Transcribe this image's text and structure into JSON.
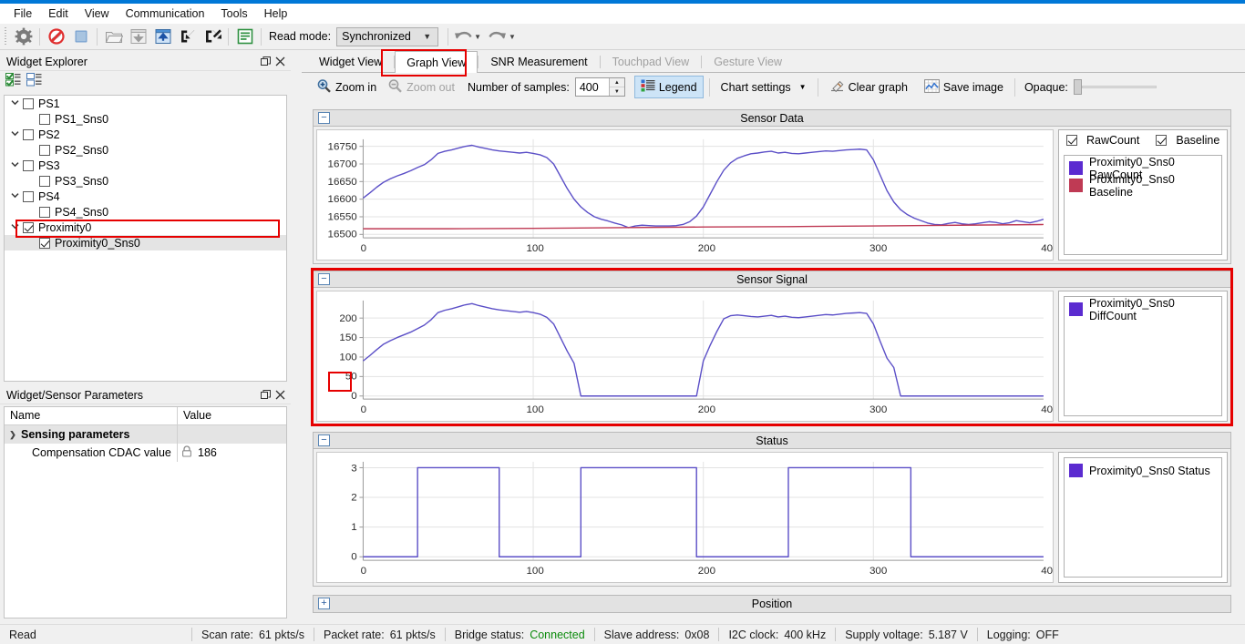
{
  "app": {
    "accent_color": "#0078d7",
    "highlight_color": "#e60000",
    "series_blue": "#5b4fc7",
    "series_red": "#bf3a54"
  },
  "menubar": {
    "items": [
      {
        "label": "File"
      },
      {
        "label": "Edit"
      },
      {
        "label": "View"
      },
      {
        "label": "Communication"
      },
      {
        "label": "Tools"
      },
      {
        "label": "Help"
      }
    ]
  },
  "toolbar": {
    "icons": [
      {
        "name": "configuration-gear-icon"
      },
      {
        "name": "disconnect-icon"
      },
      {
        "name": "stop-icon"
      },
      {
        "name": "open-folder-icon"
      },
      {
        "name": "download-to-device-icon"
      },
      {
        "name": "upload-from-device-icon"
      },
      {
        "name": "import-icon"
      },
      {
        "name": "export-icon"
      },
      {
        "name": "log-icon"
      }
    ],
    "read_mode_label": "Read mode:",
    "read_mode_value": "Synchronized",
    "undo_label": "undo",
    "redo_label": "redo"
  },
  "tabs": [
    {
      "label": "Widget View",
      "selected": false,
      "disabled": false
    },
    {
      "label": "Graph View",
      "selected": true,
      "disabled": false
    },
    {
      "label": "SNR Measurement",
      "selected": false,
      "disabled": false
    },
    {
      "label": "Touchpad View",
      "selected": false,
      "disabled": true
    },
    {
      "label": "Gesture View",
      "selected": false,
      "disabled": true
    }
  ],
  "graph_toolbar": {
    "zoom_in": "Zoom in",
    "zoom_out": "Zoom out",
    "samples_label": "Number of samples:",
    "samples_value": "400",
    "legend_label": "Legend",
    "chart_settings": "Chart settings",
    "clear_graph": "Clear graph",
    "save_image": "Save image",
    "opaque_label": "Opaque:"
  },
  "widget_explorer": {
    "title": "Widget Explorer",
    "toolbar": [
      {
        "name": "check-all-icon"
      },
      {
        "name": "uncheck-all-icon"
      }
    ],
    "float_button": "float",
    "close_button": "close",
    "tree": [
      {
        "label": "PS1",
        "level": 0,
        "checked": false,
        "expandable": true,
        "selected": false
      },
      {
        "label": "PS1_Sns0",
        "level": 1,
        "checked": false,
        "expandable": false,
        "selected": false
      },
      {
        "label": "PS2",
        "level": 0,
        "checked": false,
        "expandable": true,
        "selected": false
      },
      {
        "label": "PS2_Sns0",
        "level": 1,
        "checked": false,
        "expandable": false,
        "selected": false
      },
      {
        "label": "PS3",
        "level": 0,
        "checked": false,
        "expandable": true,
        "selected": false
      },
      {
        "label": "PS3_Sns0",
        "level": 1,
        "checked": false,
        "expandable": false,
        "selected": false
      },
      {
        "label": "PS4",
        "level": 0,
        "checked": false,
        "expandable": true,
        "selected": false
      },
      {
        "label": "PS4_Sns0",
        "level": 1,
        "checked": false,
        "expandable": false,
        "selected": false
      },
      {
        "label": "Proximity0",
        "level": 0,
        "checked": true,
        "expandable": true,
        "selected": false
      },
      {
        "label": "Proximity0_Sns0",
        "level": 1,
        "checked": true,
        "expandable": false,
        "selected": true
      }
    ]
  },
  "params_panel": {
    "title": "Widget/Sensor Parameters",
    "columns": [
      "Name",
      "Value"
    ],
    "rows": [
      {
        "name": "Sensing parameters",
        "value": "",
        "group": true
      },
      {
        "name": "Compensation CDAC value",
        "value": "186",
        "group": false,
        "locked": true
      }
    ]
  },
  "sections": [
    {
      "title": "Sensor Data",
      "collapsed": false,
      "expander": "minus",
      "legend_checks": [
        {
          "label": "RawCount",
          "checked": true
        },
        {
          "label": "Baseline",
          "checked": true
        }
      ],
      "legend_entries": [
        {
          "label": "Proximity0_Sns0 RawCount",
          "color": "#5b2bd0"
        },
        {
          "label": "Proximity0_Sns0 Baseline",
          "color": "#bf3a54"
        }
      ]
    },
    {
      "title": "Sensor Signal",
      "collapsed": false,
      "expander": "minus",
      "legend_checks": [],
      "legend_entries": [
        {
          "label": "Proximity0_Sns0 DiffCount",
          "color": "#5b2bd0"
        }
      ]
    },
    {
      "title": "Status",
      "collapsed": false,
      "expander": "minus",
      "legend_checks": [],
      "legend_entries": [
        {
          "label": "Proximity0_Sns0 Status",
          "color": "#5b2bd0"
        }
      ]
    },
    {
      "title": "Position",
      "collapsed": true,
      "expander": "plus",
      "legend_checks": [],
      "legend_entries": []
    }
  ],
  "chart_data": [
    {
      "type": "line",
      "title": "Sensor Data",
      "xlabel": "",
      "ylabel": "",
      "xlim": [
        0,
        400
      ],
      "ylim": [
        16490,
        16770
      ],
      "xticks": [
        0,
        100,
        200,
        300,
        400
      ],
      "yticks": [
        16500,
        16550,
        16600,
        16650,
        16700,
        16750
      ],
      "grid": true,
      "legend_position": "right",
      "series": [
        {
          "name": "Proximity0_Sns0 RawCount",
          "color": "#5b4fc7",
          "x": [
            0,
            4,
            8,
            12,
            16,
            20,
            24,
            28,
            32,
            36,
            40,
            44,
            48,
            52,
            56,
            60,
            64,
            68,
            72,
            76,
            80,
            84,
            88,
            92,
            96,
            100,
            104,
            108,
            112,
            116,
            120,
            124,
            128,
            132,
            136,
            140,
            144,
            148,
            152,
            156,
            160,
            164,
            168,
            172,
            176,
            180,
            184,
            188,
            192,
            196,
            200,
            204,
            208,
            212,
            216,
            220,
            224,
            228,
            232,
            236,
            240,
            244,
            248,
            252,
            256,
            260,
            264,
            268,
            272,
            276,
            280,
            284,
            288,
            292,
            296,
            300,
            304,
            308,
            312,
            316,
            320,
            324,
            328,
            332,
            336,
            340,
            344,
            348,
            352,
            356,
            360,
            364,
            368,
            372,
            376,
            380,
            384,
            388,
            392,
            396,
            400
          ],
          "y": [
            16603,
            16618,
            16634,
            16648,
            16658,
            16666,
            16673,
            16681,
            16690,
            16698,
            16712,
            16730,
            16736,
            16740,
            16745,
            16750,
            16753,
            16748,
            16744,
            16740,
            16737,
            16735,
            16733,
            16731,
            16733,
            16730,
            16726,
            16718,
            16700,
            16665,
            16630,
            16600,
            16578,
            16562,
            16550,
            16543,
            16538,
            16532,
            16527,
            16519,
            16524,
            16526,
            16525,
            16524,
            16524,
            16524,
            16525,
            16528,
            16536,
            16552,
            16578,
            16614,
            16650,
            16682,
            16703,
            16716,
            16723,
            16729,
            16731,
            16734,
            16736,
            16731,
            16733,
            16730,
            16729,
            16731,
            16733,
            16735,
            16737,
            16736,
            16738,
            16740,
            16741,
            16742,
            16740,
            16712,
            16668,
            16624,
            16592,
            16570,
            16556,
            16546,
            16539,
            16532,
            16528,
            16527,
            16531,
            16534,
            16530,
            16528,
            16530,
            16533,
            16536,
            16534,
            16530,
            16533,
            16539,
            16536,
            16533,
            16537,
            16543
          ]
        },
        {
          "name": "Proximity0_Sns0 Baseline",
          "color": "#bf3a54",
          "x": [
            0,
            50,
            100,
            150,
            200,
            250,
            300,
            350,
            400
          ],
          "y": [
            16516,
            16516,
            16517,
            16519,
            16521,
            16522,
            16524,
            16526,
            16528
          ]
        }
      ]
    },
    {
      "type": "line",
      "title": "Sensor Signal",
      "xlabel": "",
      "ylabel": "",
      "xlim": [
        0,
        400
      ],
      "ylim": [
        -8,
        245
      ],
      "xticks": [
        0,
        100,
        200,
        300,
        400
      ],
      "yticks": [
        0,
        50,
        100,
        150,
        200
      ],
      "highlighted_ytick": "50",
      "grid": true,
      "legend_position": "right",
      "series": [
        {
          "name": "Proximity0_Sns0 DiffCount",
          "color": "#5b4fc7",
          "x": [
            0,
            4,
            8,
            12,
            16,
            20,
            24,
            28,
            32,
            36,
            40,
            44,
            48,
            52,
            56,
            60,
            64,
            68,
            72,
            76,
            80,
            84,
            88,
            92,
            96,
            100,
            104,
            108,
            112,
            116,
            120,
            124,
            128,
            132,
            136,
            140,
            144,
            148,
            152,
            156,
            160,
            164,
            168,
            172,
            176,
            180,
            184,
            188,
            192,
            196,
            200,
            204,
            208,
            212,
            216,
            220,
            224,
            228,
            232,
            236,
            240,
            244,
            248,
            252,
            256,
            260,
            264,
            268,
            272,
            276,
            280,
            284,
            288,
            292,
            296,
            300,
            304,
            308,
            312,
            316,
            320,
            324,
            328,
            332,
            336,
            340,
            344,
            348,
            352,
            356,
            360,
            364,
            368,
            372,
            376,
            380,
            384,
            388,
            392,
            396,
            400
          ],
          "y": [
            90,
            104,
            119,
            133,
            142,
            150,
            157,
            164,
            173,
            182,
            196,
            214,
            220,
            224,
            229,
            234,
            237,
            232,
            228,
            224,
            221,
            219,
            217,
            215,
            217,
            214,
            210,
            202,
            185,
            150,
            115,
            84,
            0,
            0,
            0,
            0,
            0,
            0,
            0,
            0,
            0,
            0,
            0,
            0,
            0,
            0,
            0,
            0,
            0,
            0,
            90,
            130,
            166,
            198,
            206,
            208,
            206,
            204,
            203,
            205,
            207,
            203,
            205,
            202,
            201,
            203,
            205,
            207,
            209,
            208,
            210,
            212,
            213,
            214,
            212,
            185,
            140,
            97,
            73,
            0,
            0,
            0,
            0,
            0,
            0,
            0,
            0,
            0,
            0,
            0,
            0,
            0,
            0,
            0,
            0,
            0,
            0,
            0,
            0,
            0,
            0
          ]
        }
      ]
    },
    {
      "type": "line",
      "title": "Status",
      "xlabel": "",
      "ylabel": "",
      "xlim": [
        0,
        400
      ],
      "ylim": [
        -0.12,
        3.2
      ],
      "xticks": [
        0,
        100,
        200,
        300,
        400
      ],
      "yticks": [
        0,
        1,
        2,
        3
      ],
      "grid": true,
      "legend_position": "right",
      "series": [
        {
          "name": "Proximity0_Sns0 Status",
          "color": "#5b4fc7",
          "x": [
            0,
            32,
            32,
            80,
            80,
            128,
            128,
            196,
            196,
            250,
            250,
            322,
            322,
            400
          ],
          "y": [
            0,
            0,
            3,
            3,
            0,
            0,
            3,
            3,
            0,
            0,
            3,
            3,
            0,
            0
          ]
        }
      ]
    }
  ],
  "statusbar": {
    "state": "Read",
    "items": [
      {
        "key": "Scan rate:",
        "value": "61 pkts/s",
        "status": false
      },
      {
        "key": "Packet rate:",
        "value": "61 pkts/s",
        "status": false
      },
      {
        "key": "Bridge status:",
        "value": "Connected",
        "status": true
      },
      {
        "key": "Slave address:",
        "value": "0x08",
        "status": false
      },
      {
        "key": "I2C clock:",
        "value": "400 kHz",
        "status": false
      },
      {
        "key": "Supply voltage:",
        "value": "5.187 V",
        "status": false
      },
      {
        "key": "Logging:",
        "value": "OFF",
        "status": false
      }
    ]
  }
}
